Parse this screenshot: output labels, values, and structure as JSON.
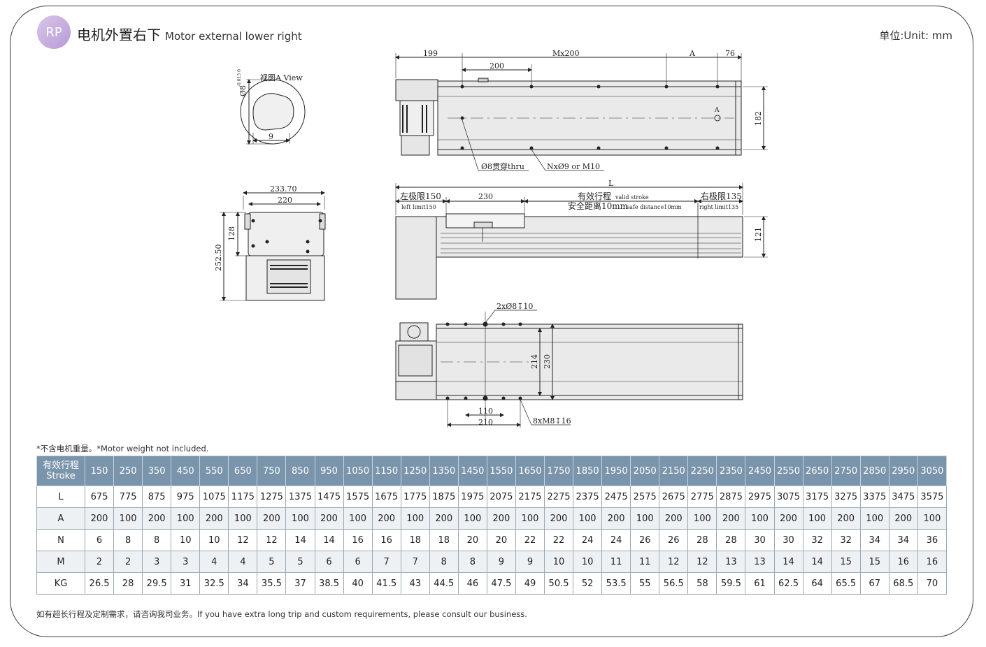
{
  "header": {
    "badge": "RP",
    "title_cn": "电机外置右下",
    "title_en": "Motor external lower right",
    "unit": "单位:Unit: mm"
  },
  "drawing": {
    "view_a_label": "视图A View",
    "view_a_dia": "Ø8",
    "view_a_tol": "-0.015 0",
    "view_a_width": "9",
    "front_233": "233.70",
    "front_220": "220",
    "front_128": "128",
    "front_252": "252.50",
    "top_199": "199",
    "top_mx200": "Mx200",
    "top_a": "A",
    "top_76": "76",
    "top_200": "200",
    "top_182": "182",
    "top_a_mark": "A",
    "top_thru": "Ø8贯穿thru",
    "top_nx": "NxØ9 or M10",
    "side_L": "L",
    "side_left_limit_cn": "左极限150",
    "side_left_limit_en": "left limit150",
    "side_230": "230",
    "side_valid_cn": "有效行程",
    "side_valid_en": "valid stroke",
    "side_safe_cn": "安全距离10mm",
    "side_safe_en": "safe distance10mm",
    "side_right_limit_cn": "右极限135",
    "side_right_limit_en": "right limit135",
    "side_121": "121",
    "bottom_2x": "2xØ8↧10",
    "bottom_214": "214",
    "bottom_230": "230",
    "bottom_110": "110",
    "bottom_210": "210",
    "bottom_8x": "8xM8↧16"
  },
  "note": "*不含电机重量。*Motor weight not included.",
  "table": {
    "header_label_cn": "有效行程",
    "header_label_en": "Stroke",
    "strokes": [
      "150",
      "250",
      "350",
      "450",
      "550",
      "650",
      "750",
      "850",
      "950",
      "1050",
      "1150",
      "1250",
      "1350",
      "1450",
      "1550",
      "1650",
      "1750",
      "1850",
      "1950",
      "2050",
      "2150",
      "2250",
      "2350",
      "2450",
      "2550",
      "2650",
      "2750",
      "2850",
      "2950",
      "3050"
    ],
    "rows": [
      {
        "label": "L",
        "values": [
          "675",
          "775",
          "875",
          "975",
          "1075",
          "1175",
          "1275",
          "1375",
          "1475",
          "1575",
          "1675",
          "1775",
          "1875",
          "1975",
          "2075",
          "2175",
          "2275",
          "2375",
          "2475",
          "2575",
          "2675",
          "2775",
          "2875",
          "2975",
          "3075",
          "3175",
          "3275",
          "3375",
          "3475",
          "3575"
        ]
      },
      {
        "label": "A",
        "values": [
          "200",
          "100",
          "200",
          "100",
          "200",
          "100",
          "200",
          "100",
          "200",
          "100",
          "200",
          "100",
          "200",
          "100",
          "200",
          "100",
          "200",
          "100",
          "200",
          "100",
          "200",
          "100",
          "200",
          "100",
          "200",
          "100",
          "200",
          "100",
          "200",
          "100"
        ]
      },
      {
        "label": "N",
        "values": [
          "6",
          "8",
          "8",
          "10",
          "10",
          "12",
          "12",
          "14",
          "14",
          "16",
          "16",
          "18",
          "18",
          "20",
          "20",
          "22",
          "22",
          "24",
          "24",
          "26",
          "26",
          "28",
          "28",
          "30",
          "30",
          "32",
          "32",
          "34",
          "34",
          "36"
        ]
      },
      {
        "label": "M",
        "values": [
          "2",
          "2",
          "3",
          "3",
          "4",
          "4",
          "5",
          "5",
          "6",
          "6",
          "7",
          "7",
          "8",
          "8",
          "9",
          "9",
          "10",
          "10",
          "11",
          "11",
          "12",
          "12",
          "13",
          "13",
          "14",
          "14",
          "15",
          "15",
          "16",
          "16"
        ]
      },
      {
        "label": "KG",
        "values": [
          "26.5",
          "28",
          "29.5",
          "31",
          "32.5",
          "34",
          "35.5",
          "37",
          "38.5",
          "40",
          "41.5",
          "43",
          "44.5",
          "46",
          "47.5",
          "49",
          "50.5",
          "52",
          "53.5",
          "55",
          "56.5",
          "58",
          "59.5",
          "61",
          "62.5",
          "64",
          "65.5",
          "67",
          "68.5",
          "70"
        ]
      }
    ]
  },
  "footer": "如有超长行程及定制需求，请咨询我司业务。If you have extra long trip and custom requirements, please consult our business."
}
